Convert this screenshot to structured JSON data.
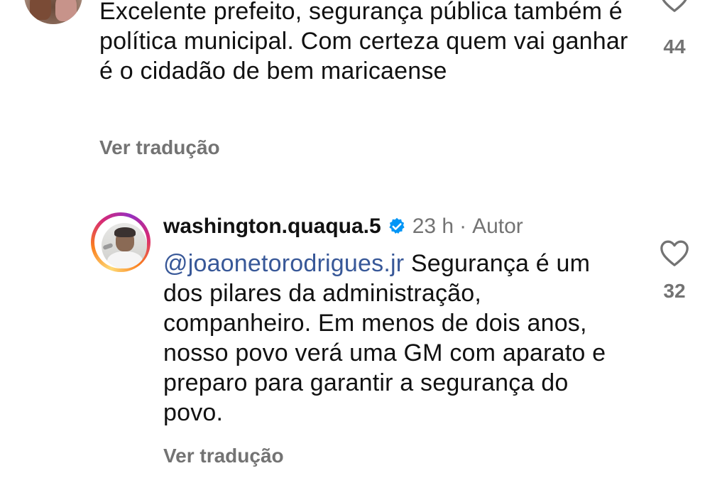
{
  "comments": [
    {
      "text": "Excelente prefeito, segurança pública também é política municipal. Com certeza quem vai ganhar é o cidadão de bem maricaense",
      "translate_label": "Ver tradução",
      "likes": "44"
    },
    {
      "username": "washington.quaqua.5",
      "verified": true,
      "time": "23 h",
      "separator": "·",
      "author_label": "Autor",
      "mention": "@joaonetorodrigues.jr",
      "text": " Segurança é um dos pilares da administração, companheiro. Em menos de dois anos, nosso povo verá uma GM com aparato e preparo para garantir a segurança do povo.",
      "translate_label": "Ver tradução",
      "likes": "32"
    }
  ],
  "icons": {
    "like": "heart-outline-icon",
    "verified": "verified-badge-icon"
  },
  "colors": {
    "mention": "#385898",
    "verified": "#0095f6",
    "secondary_text": "#737373"
  }
}
